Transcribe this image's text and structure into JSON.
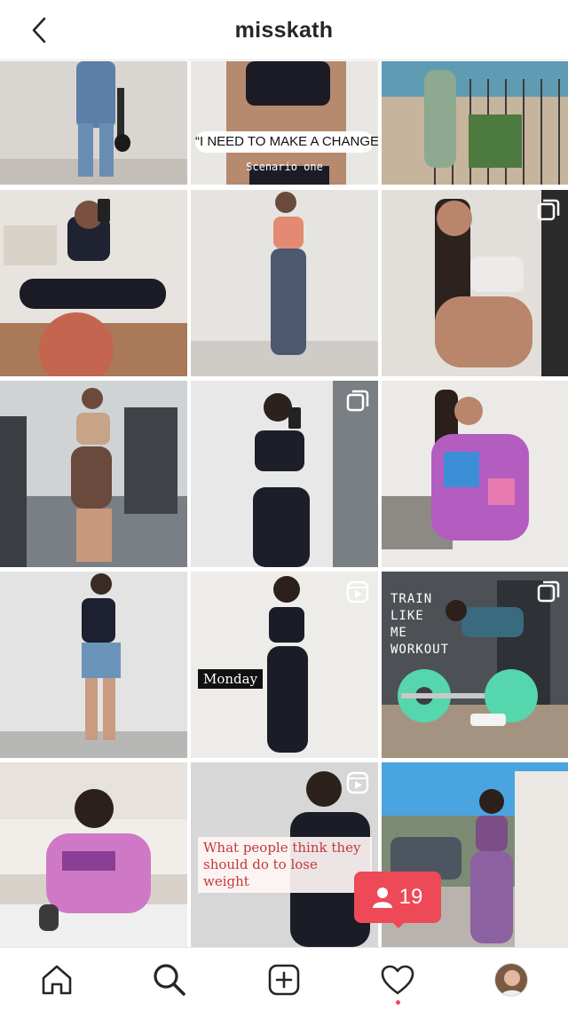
{
  "header": {
    "title": "misskath",
    "back_icon": "chevron-left-icon"
  },
  "grid": {
    "tiles": [
      {
        "id": "r1c1"
      },
      {
        "id": "r1c2",
        "caption_pill": "“I NEED TO MAKE A CHANGE!”",
        "caption_sub": "Scenario one"
      },
      {
        "id": "r1c3"
      },
      {
        "id": "r2c1"
      },
      {
        "id": "r2c2"
      },
      {
        "id": "r2c3",
        "badge": "multi-post-icon"
      },
      {
        "id": "r3c1"
      },
      {
        "id": "r3c2",
        "badge": "multi-post-icon"
      },
      {
        "id": "r3c3"
      },
      {
        "id": "r4c1"
      },
      {
        "id": "r4c2",
        "badge": "reels-icon",
        "caption_box": "Monday"
      },
      {
        "id": "r4c3",
        "badge": "multi-post-icon",
        "caption_lines": [
          "TRAIN",
          "LIKE",
          "ME",
          "WORKOUT"
        ]
      },
      {
        "id": "r5c1"
      },
      {
        "id": "r5c2",
        "badge": "reels-icon",
        "caption_note": "What people think they should do to lose weight"
      },
      {
        "id": "r5c3"
      }
    ]
  },
  "activity": {
    "icon": "follower-icon",
    "count": "19",
    "color": "#ed4956"
  },
  "bottom_nav": {
    "items": [
      "home-icon",
      "search-icon",
      "new-post-icon",
      "activity-heart-icon",
      "profile-avatar"
    ]
  },
  "colors": {
    "accent_red": "#ed4956",
    "text_primary": "#262626"
  }
}
